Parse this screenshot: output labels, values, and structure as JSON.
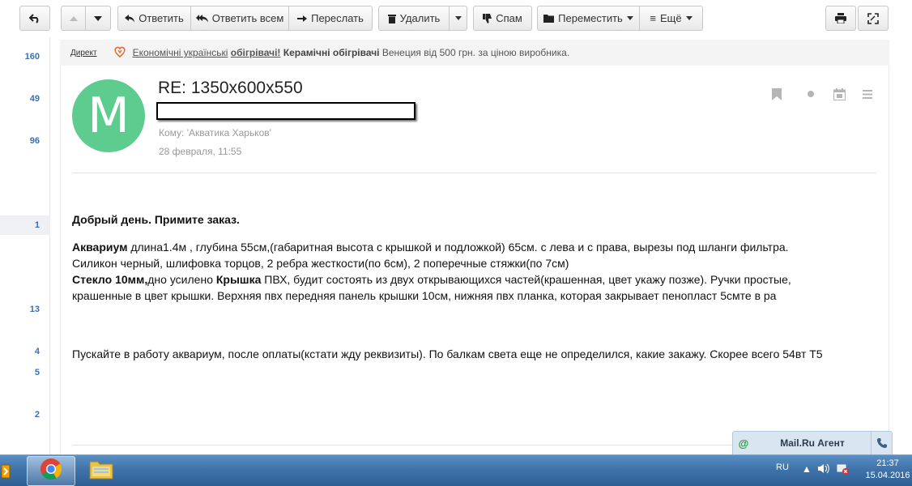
{
  "toolbar": {
    "reply": "Ответить",
    "reply_all": "Ответить всем",
    "forward": "Переслать",
    "delete": "Удалить",
    "spam": "Спам",
    "move": "Переместить",
    "more": "Ещё"
  },
  "counters": [
    "160",
    "49",
    "96",
    "1",
    "13",
    "4",
    "5",
    "2"
  ],
  "ad": {
    "direct": "Директ",
    "link": "Економічні українські",
    "link_bold": "обігрівачі!",
    "bold": "Керамічні обігрівачі",
    "text": "Венеция від 500 грн. за ціною виробника."
  },
  "message": {
    "avatar_letter": "M",
    "subject": "RE: 1350x600x550",
    "to": "Кому: 'Акватика Харьков'",
    "date": "28 февраля, 11:55",
    "greeting": "Добрый день. Примите заказ.",
    "aq_label": "Аквариум",
    "aq_text": " длина1.4м , глубина 55см,(габаритная высота с крышкой и подложкой) 65см. с лева и с права, вырезы под шланги фильтра.",
    "line2": "Силикон черный, шлифовка торцов, 2 ребра жесткости(по 6см), 2 поперечные стяжки(по 7см)",
    "glass_label": "Стекло 10мм,",
    "glass_text": "дно усилено ",
    "lid_label": "Крышка",
    "lid_text": " ПВХ, будит состоять из двух открывающихся частей(крашенная, цвет укажу позже). Ручки простые,",
    "line4": "крашенные в цвет крышки. Верхняя пвх передняя панель крышки 10см, нижняя пвх планка, которая закрывает пенопласт 5смте в ра",
    "closing": "Пускайте в работу аквариум, после оплаты(кстати жду реквизиты). По балкам света еще не определился, какие закажу. Скорее всего 54вт Т5"
  },
  "agent": {
    "label": "Mail.Ru Агент"
  },
  "taskbar": {
    "lang": "RU",
    "time": "21:37",
    "date": "15.04.2016"
  },
  "colors": {
    "avatar": "#5fcc8f",
    "counter": "#3a6fb5",
    "taskbar": "#3f73aa"
  }
}
